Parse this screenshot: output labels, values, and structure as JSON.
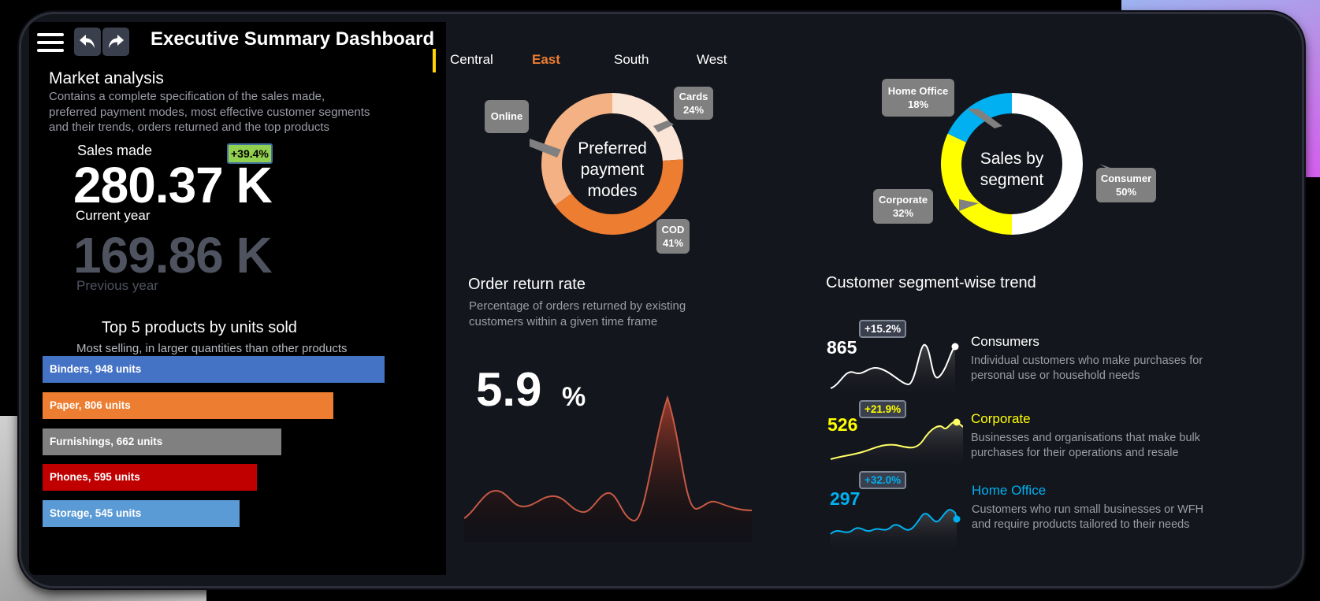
{
  "header": {
    "title": "Executive Summary Dashboard",
    "menu_icon": "hamburger-menu-icon",
    "undo_icon": "undo-arrow-icon",
    "redo_icon": "redo-arrow-icon"
  },
  "tabs": [
    {
      "label": "Central",
      "active": false
    },
    {
      "label": "East",
      "active": true
    },
    {
      "label": "South",
      "active": false
    },
    {
      "label": "West",
      "active": false
    }
  ],
  "market": {
    "title": "Market analysis",
    "description": "Contains a complete specification of the sales made, preferred payment modes, most effective customer segments and their trends, orders returned and the top products"
  },
  "sales": {
    "label": "Sales made",
    "change": "+39.4%",
    "current_value": "280.37 K",
    "current_label": "Current year",
    "previous_value": "169.86 K",
    "previous_label": "Previous year"
  },
  "top_products": {
    "title": "Top 5 products by units sold",
    "subtitle": "Most selling, in larger quantities than other products",
    "items": [
      {
        "label": "Binders, 948 units",
        "value": 948,
        "color": "#4472c4"
      },
      {
        "label": "Paper, 806 units",
        "value": 806,
        "color": "#ed7d31"
      },
      {
        "label": "Furnishings, 662 units",
        "value": 662,
        "color": "#808080"
      },
      {
        "label": "Phones, 595 units",
        "value": 595,
        "color": "#c00000"
      },
      {
        "label": "Storage, 545 units",
        "value": 545,
        "color": "#5b9bd5"
      }
    ]
  },
  "payment": {
    "center_line1": "Preferred",
    "center_line2": "payment",
    "center_line3": "modes",
    "online_label": "Online",
    "cards_label": "Cards",
    "cards_pct": "24%",
    "cod_label": "COD",
    "cod_pct": "41%",
    "colors": {
      "online": "#f4b183",
      "cards": "#fbe5d6",
      "cod": "#ed7d31"
    }
  },
  "segment": {
    "center_line1": "Sales by",
    "center_line2": "segment",
    "home_label": "Home Office",
    "home_pct": "18%",
    "consumer_label": "Consumer",
    "consumer_pct": "50%",
    "corporate_label": "Corporate",
    "corporate_pct": "32%",
    "colors": {
      "consumer": "#ffffff",
      "corporate": "#ffff00",
      "home": "#00b0f0"
    }
  },
  "returns": {
    "title": "Order return rate",
    "description": "Percentage of orders returned by existing customers within a given time frame",
    "value": "5.9",
    "unit": "%",
    "line_color": "#c55a45"
  },
  "trend": {
    "title": "Customer segment-wise trend",
    "rows": [
      {
        "number": "865",
        "change": "+15.2%",
        "name": "Consumers",
        "description": "Individual customers who make purchases for personal use or household needs",
        "color": "#ffffff"
      },
      {
        "number": "526",
        "change": "+21.9%",
        "name": "Corporate",
        "description": "Businesses and organisations that make bulk purchases for their operations and resale",
        "color": "#ffff00"
      },
      {
        "number": "297",
        "change": "+32.0%",
        "name": "Home Office",
        "description": "Customers who run small businesses or WFH and require products tailored to their needs",
        "color": "#00b0f0"
      }
    ]
  }
}
